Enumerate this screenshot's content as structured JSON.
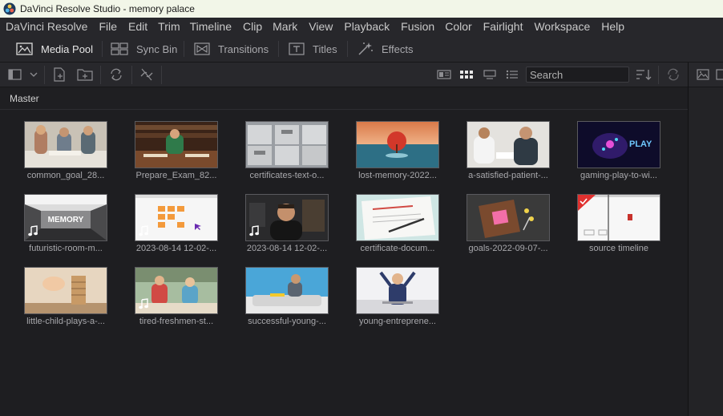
{
  "window": {
    "title": "DaVinci Resolve Studio - memory palace"
  },
  "menu": [
    "DaVinci Resolve",
    "File",
    "Edit",
    "Trim",
    "Timeline",
    "Clip",
    "Mark",
    "View",
    "Playback",
    "Fusion",
    "Color",
    "Fairlight",
    "Workspace",
    "Help"
  ],
  "toolbar": {
    "media_pool": "Media Pool",
    "sync_bin": "Sync Bin",
    "transitions": "Transitions",
    "titles": "Titles",
    "effects": "Effects"
  },
  "search": {
    "placeholder": "Search"
  },
  "bin": {
    "name": "Master"
  },
  "clips": [
    {
      "label": "common_goal_28...",
      "icon": "office-meeting-thumbnail",
      "audio": false
    },
    {
      "label": "Prepare_Exam_82...",
      "icon": "library-study-thumbnail",
      "audio": false
    },
    {
      "label": "certificates-text-o...",
      "icon": "file-cabinets-thumbnail",
      "audio": false
    },
    {
      "label": "lost-memory-2022...",
      "icon": "red-tree-sea-thumbnail",
      "audio": false
    },
    {
      "label": "a-satisfied-patient-...",
      "icon": "patient-doctor-thumbnail",
      "audio": false
    },
    {
      "label": "gaming-play-to-wi...",
      "icon": "neon-play-thumbnail",
      "audio": false
    },
    {
      "label": "futuristic-room-m...",
      "icon": "memory-room-thumbnail",
      "audio": true,
      "overlay_text": "MEMORY"
    },
    {
      "label": "2023-08-14 12-02-...",
      "icon": "screen-recording-thumbnail",
      "audio": true
    },
    {
      "label": "2023-08-14 12-02-...",
      "icon": "man-webcam-thumbnail",
      "audio": true
    },
    {
      "label": "certificate-docum...",
      "icon": "certificate-paper-thumbnail",
      "audio": false
    },
    {
      "label": "goals-2022-09-07-...",
      "icon": "notebook-sticky-thumbnail",
      "audio": false
    },
    {
      "label": "source timeline",
      "icon": "timeline-thumbnail",
      "audio": false,
      "timeline": true
    },
    {
      "label": "little-child-plays-a-...",
      "icon": "wooden-blocks-thumbnail",
      "audio": false
    },
    {
      "label": "tired-freshmen-st...",
      "icon": "students-library-thumbnail",
      "audio": true
    },
    {
      "label": "successful-young-...",
      "icon": "man-laptop-thumbnail",
      "audio": false
    },
    {
      "label": "young-entreprene...",
      "icon": "businessman-celebrate-thumbnail",
      "audio": false
    }
  ],
  "colors": {
    "accent": "#e0312f",
    "background": "#1e1e21",
    "titlebar": "#f2f6e8"
  }
}
